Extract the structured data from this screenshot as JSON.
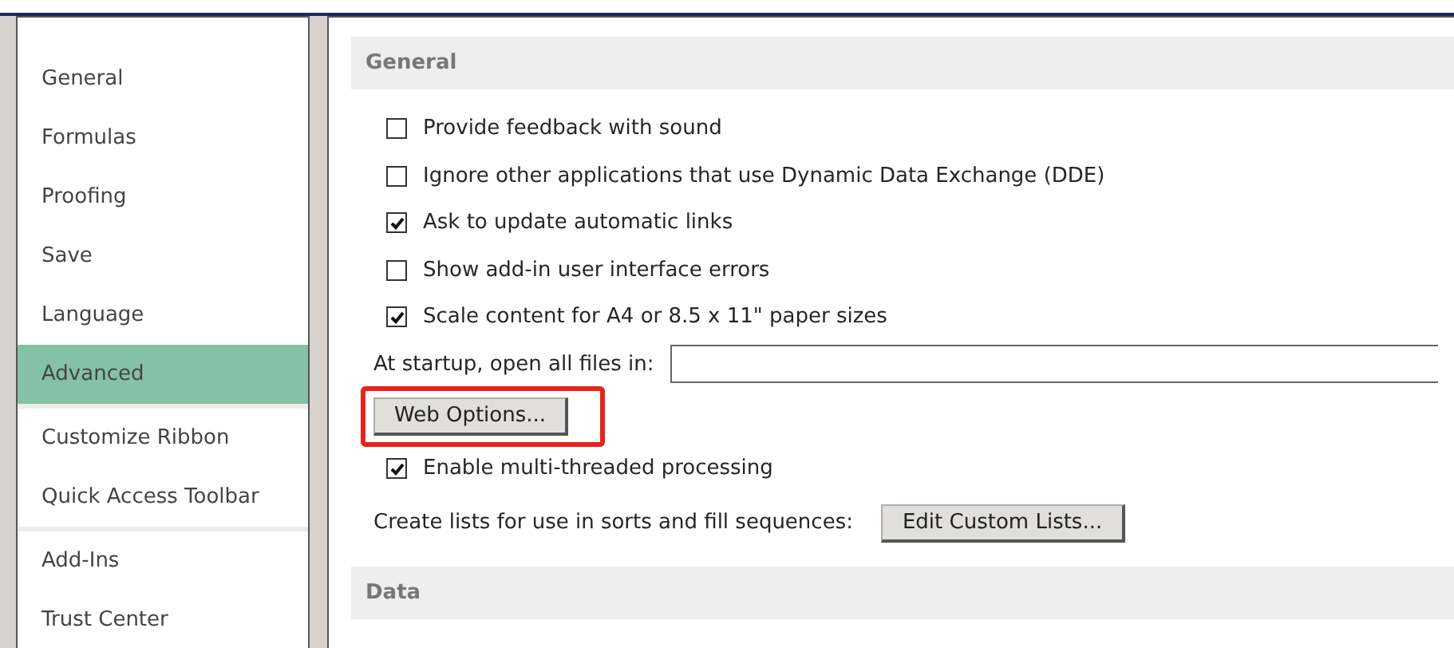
{
  "sidebar": {
    "groups": [
      [
        {
          "label": "General",
          "selected": false
        },
        {
          "label": "Formulas",
          "selected": false
        },
        {
          "label": "Proofing",
          "selected": false
        },
        {
          "label": "Save",
          "selected": false
        },
        {
          "label": "Language",
          "selected": false
        },
        {
          "label": "Advanced",
          "selected": true
        }
      ],
      [
        {
          "label": "Customize Ribbon",
          "selected": false
        },
        {
          "label": "Quick Access Toolbar",
          "selected": false
        }
      ],
      [
        {
          "label": "Add-Ins",
          "selected": false
        },
        {
          "label": "Trust Center",
          "selected": false
        }
      ]
    ]
  },
  "sections": [
    {
      "title": "General",
      "items": [
        {
          "kind": "checkbox",
          "label": "Provide feedback with sound",
          "checked": false
        },
        {
          "kind": "checkbox",
          "label": "Ignore other applications that use Dynamic Data Exchange (DDE)",
          "checked": false
        },
        {
          "kind": "checkbox",
          "label": "Ask to update automatic links",
          "checked": true
        },
        {
          "kind": "checkbox",
          "label": "Show add-in user interface errors",
          "checked": false
        },
        {
          "kind": "checkbox",
          "label": "Scale content for A4 or 8.5 x 11\" paper sizes",
          "checked": true
        },
        {
          "kind": "field",
          "label": "At startup, open all files in:"
        },
        {
          "kind": "button",
          "label": "Web Options...",
          "highlighted": true
        },
        {
          "kind": "checkbox",
          "label": "Enable multi-threaded processing",
          "checked": true
        },
        {
          "kind": "labeled_button",
          "label": "Create lists for use in sorts and fill sequences:",
          "button": "Edit Custom Lists..."
        }
      ]
    },
    {
      "title": "Data"
    }
  ]
}
